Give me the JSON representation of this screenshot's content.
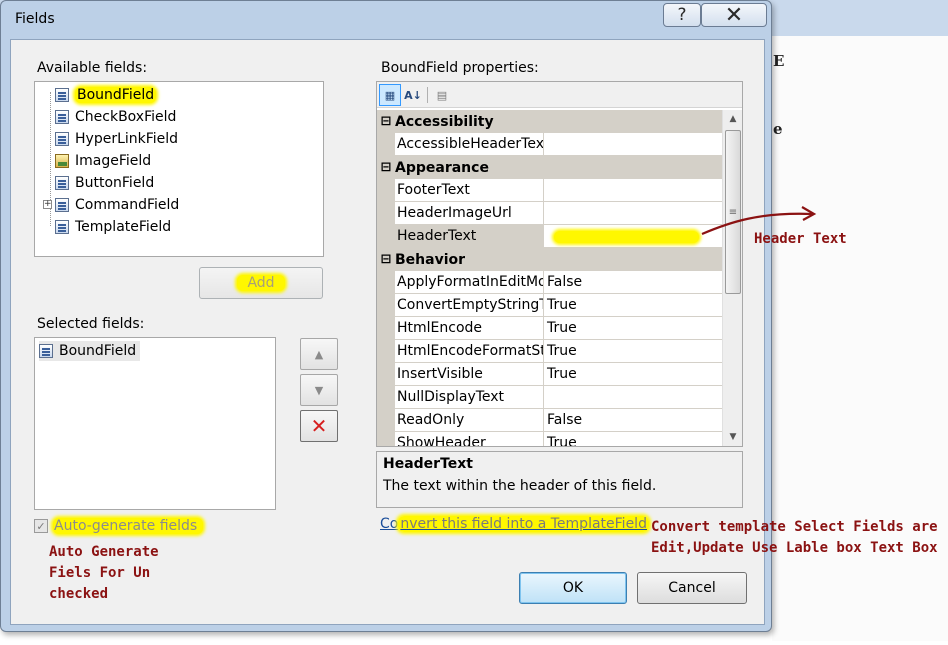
{
  "dialog": {
    "title": "Fields",
    "help_glyph": "?",
    "close_glyph": "✕"
  },
  "available": {
    "label": "Available fields:",
    "items": [
      {
        "label": "BoundField",
        "icon": "bound-field-icon"
      },
      {
        "label": "CheckBoxField",
        "icon": "checkbox-field-icon"
      },
      {
        "label": "HyperLinkField",
        "icon": "hyperlink-field-icon"
      },
      {
        "label": "ImageField",
        "icon": "image-field-icon"
      },
      {
        "label": "ButtonField",
        "icon": "button-field-icon"
      },
      {
        "label": "CommandField",
        "icon": "command-field-icon"
      },
      {
        "label": "TemplateField",
        "icon": "template-field-icon"
      }
    ],
    "add_label": "Add"
  },
  "selected": {
    "label": "Selected fields:",
    "items": [
      {
        "label": "BoundField",
        "icon": "bound-field-icon"
      }
    ],
    "move_up_glyph": "▲",
    "move_down_glyph": "▼",
    "delete_glyph": "✕"
  },
  "properties": {
    "label": "BoundField properties:",
    "toolbar": {
      "categorized_icon": "categorized-icon",
      "alphabetical_icon": "alphabetical-sort-icon",
      "property_pages_icon": "property-pages-icon"
    },
    "categories": [
      {
        "name": "Accessibility",
        "rows": [
          {
            "name": "AccessibleHeaderText",
            "value": ""
          }
        ]
      },
      {
        "name": "Appearance",
        "rows": [
          {
            "name": "FooterText",
            "value": ""
          },
          {
            "name": "HeaderImageUrl",
            "value": ""
          },
          {
            "name": "HeaderText",
            "value": ""
          }
        ]
      },
      {
        "name": "Behavior",
        "rows": [
          {
            "name": "ApplyFormatInEditMo",
            "value": "False"
          },
          {
            "name": "ConvertEmptyStringTc",
            "value": "True"
          },
          {
            "name": "HtmlEncode",
            "value": "True"
          },
          {
            "name": "HtmlEncodeFormatStr",
            "value": "True"
          },
          {
            "name": "InsertVisible",
            "value": "True"
          },
          {
            "name": "NullDisplayText",
            "value": ""
          },
          {
            "name": "ReadOnly",
            "value": "False"
          },
          {
            "name": "ShowHeader",
            "value": "True"
          }
        ]
      }
    ],
    "collapse_glyph": "⊟",
    "scroll_up_glyph": "▲",
    "scroll_down_glyph": "▼",
    "thumb_glyph": "≡"
  },
  "description": {
    "title": "HeaderText",
    "text": "The text within the header of this field."
  },
  "convert_link": {
    "lead": "Co",
    "rest": "nvert this field into a TemplateField"
  },
  "auto_generate": {
    "label": "Auto-generate fields",
    "checked": true
  },
  "buttons": {
    "ok": "OK",
    "cancel": "Cancel"
  },
  "annotations": {
    "header_text": "Header Text",
    "convert_note": "Convert template Select Fields are\nEdit,Update Use Lable box Text Box",
    "auto_note": "Auto Generate\nFiels For Un\nchecked"
  },
  "colors": {
    "highlight": "#fff700",
    "annotation": "#8b1212",
    "dialog_frame": "#bcd0e7"
  }
}
